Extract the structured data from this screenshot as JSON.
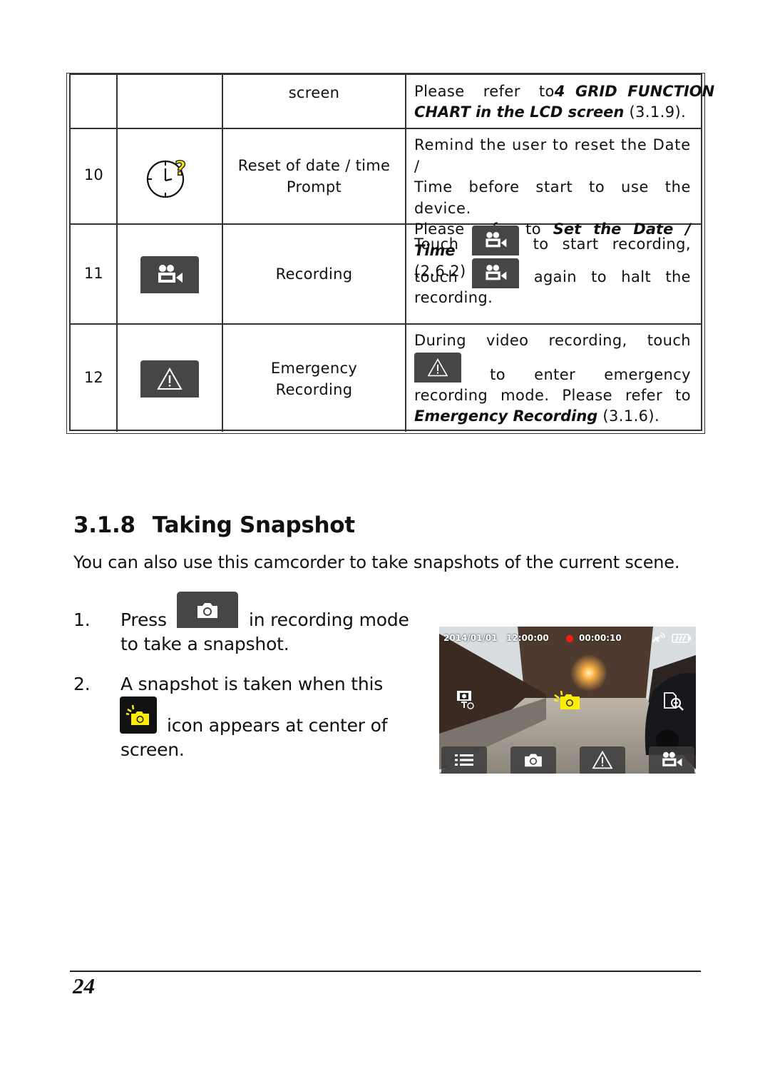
{
  "table": {
    "rows": [
      {
        "num": "",
        "icon": "",
        "name": "screen",
        "desc_parts": [
          {
            "text": "Please refer to ",
            "bold": false
          },
          {
            "text": "4 GRID FUNCTION CHART in the LCD screen",
            "bold": true
          },
          {
            "text": " (3.1.9).",
            "bold": false
          }
        ],
        "desc_line1": "Please  refer  to",
        "desc_line1_bold": "4  GRID  FUNCTION",
        "desc_line2_bold": "CHART in the LCD screen",
        "desc_line2": " (3.1.9)."
      },
      {
        "num": "10",
        "icon": "clock-question-icon",
        "name_line1": "Reset of date / time",
        "name_line2": "Prompt",
        "desc_line1": "Remind the user to reset the Date /",
        "desc_line2": "Time before start to use the device.",
        "desc_line3": "Please refer to ",
        "desc_line3_bold": "Set the Date / Time",
        "desc_line4": "(2.6.2)"
      },
      {
        "num": "11",
        "icon": "video-camera-icon",
        "name": "Recording",
        "desc_l1_a": "Touch",
        "desc_l1_b": "to",
        "desc_l1_c": "start",
        "desc_l1_d": "recording,",
        "desc_l2_a": "touch",
        "desc_l2_b": "again",
        "desc_l2_c": "to",
        "desc_l2_d": "halt",
        "desc_l2_e": "the",
        "desc_l3": "recording."
      },
      {
        "num": "12",
        "icon": "warning-triangle-icon",
        "name_line1": "Emergency",
        "name_line2": "Recording",
        "desc_l1_a": "During",
        "desc_l1_b": "video",
        "desc_l1_c": "recording,",
        "desc_l1_d": "touch",
        "desc_l2_a": "to",
        "desc_l2_b": "enter",
        "desc_l2_c": "emergency",
        "desc_l3_a": "recording",
        "desc_l3_b": "mode.",
        "desc_l3_c": "Please",
        "desc_l3_d": "refer",
        "desc_l3_e": "to",
        "desc_l4_bold": "Emergency Recording",
        "desc_l4": " (3.1.6)."
      }
    ]
  },
  "section": {
    "number": "3.1.8",
    "title": "Taking Snapshot",
    "intro": "You can also use this camcorder to take snapshots of the current scene.",
    "steps": [
      {
        "num": "1.",
        "text_before": "Press",
        "text_after": "in recording mode",
        "text_line2": "to take a snapshot."
      },
      {
        "num": "2.",
        "text_line1": "A snapshot is taken when this",
        "text_after": "icon appears at center of",
        "text_line3": "screen."
      }
    ]
  },
  "lcd": {
    "date": "2014/01/01",
    "time": "12:00:00",
    "elapsed": "00:00:10",
    "recording_dot_color": "#ff1a1a",
    "snapshot_icon_color": "#ffee00",
    "bottom_buttons": [
      "menu-icon",
      "camera-icon",
      "warning-triangle-icon",
      "video-camera-icon"
    ]
  },
  "footer": {
    "page_number": "24"
  }
}
